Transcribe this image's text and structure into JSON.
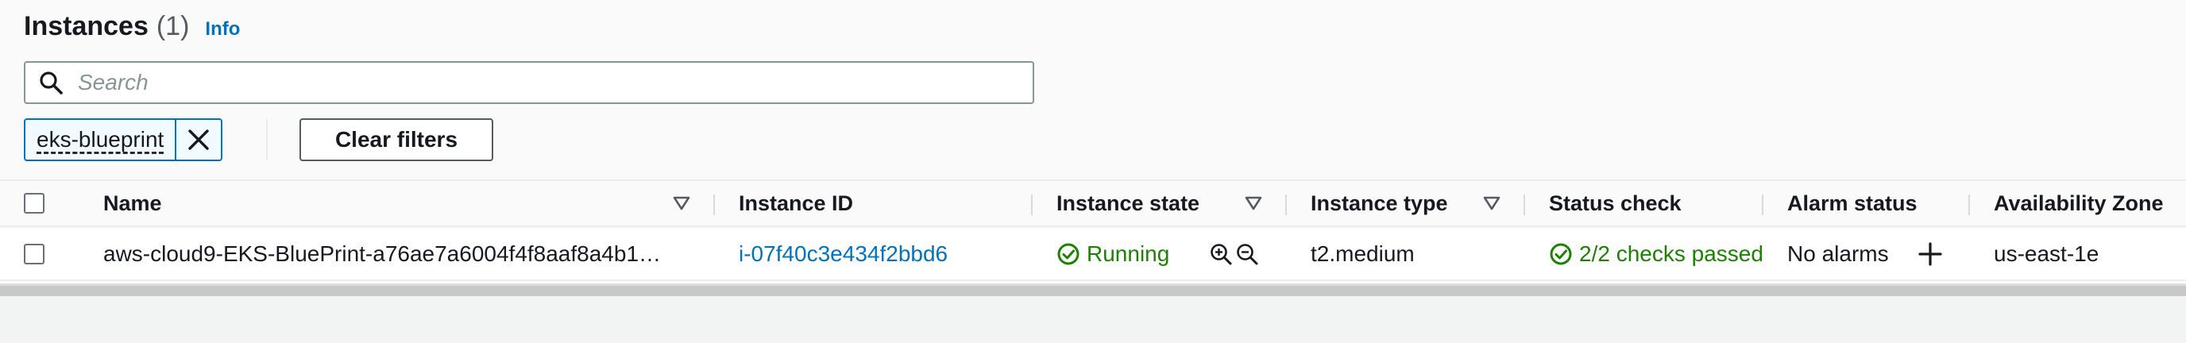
{
  "header": {
    "title": "Instances",
    "count": "(1)",
    "info": "Info"
  },
  "search": {
    "placeholder": "Search",
    "value": ""
  },
  "filters": {
    "token": "eks-blueprint",
    "clear_label": "Clear filters"
  },
  "columns": [
    "Name",
    "Instance ID",
    "Instance state",
    "Instance type",
    "Status check",
    "Alarm status",
    "Availability Zone"
  ],
  "rows": [
    {
      "name": "aws-cloud9-EKS-BluePrint-a76ae7a6004f4f8aaf8a4b1…",
      "instance_id": "i-07f40c3e434f2bbd6",
      "state": "Running",
      "type": "t2.medium",
      "status_check": "2/2 checks passed",
      "alarm_status": "No alarms",
      "az": "us-east-1e"
    }
  ],
  "colors": {
    "link": "#0073bb",
    "success": "#1d8102",
    "border": "#879596"
  },
  "icons": [
    "search-icon",
    "close-icon",
    "sort-caret-icon",
    "check-circle-icon",
    "zoom-in-icon",
    "zoom-out-icon",
    "plus-icon"
  ]
}
